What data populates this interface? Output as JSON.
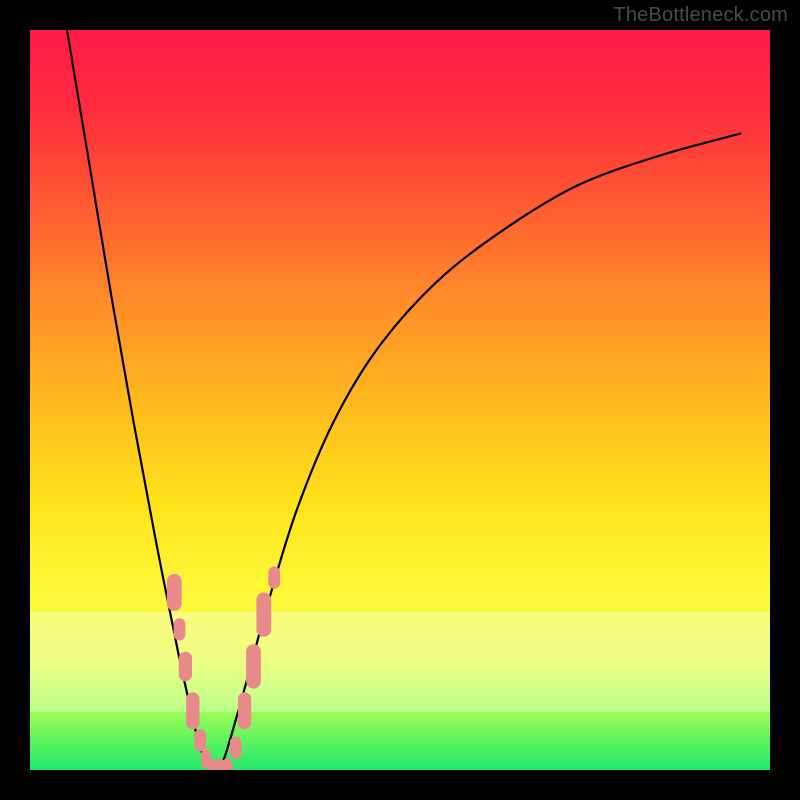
{
  "watermark": "TheBottleneck.com",
  "chart_data": {
    "type": "line",
    "title": "",
    "xlabel": "",
    "ylabel": "",
    "xlim": [
      0,
      100
    ],
    "ylim": [
      0,
      100
    ],
    "legend": false,
    "grid": false,
    "background_gradient": [
      "#ff1a48",
      "#ff8a2a",
      "#ffe31a",
      "#22e86b"
    ],
    "series": [
      {
        "name": "bottleneck-curve",
        "x": [
          5,
          8,
          11,
          14,
          17,
          20,
          22,
          23,
          24,
          25,
          26,
          27,
          29,
          32,
          36,
          41,
          47,
          55,
          64,
          74,
          85,
          96
        ],
        "y": [
          100,
          82,
          64,
          47,
          31,
          16,
          7,
          3,
          1,
          0,
          1,
          4,
          11,
          22,
          35,
          47,
          57,
          66,
          73,
          79,
          83,
          86
        ]
      }
    ],
    "markers": [
      {
        "name": "pink-beads",
        "shape": "rounded-rect",
        "color": "#e98a8a",
        "points": [
          {
            "x": 19.5,
            "y": 24,
            "w": 2.0,
            "h": 5
          },
          {
            "x": 20.2,
            "y": 19,
            "w": 1.6,
            "h": 3
          },
          {
            "x": 21.0,
            "y": 14,
            "w": 1.8,
            "h": 4
          },
          {
            "x": 22.0,
            "y": 8,
            "w": 1.8,
            "h": 5
          },
          {
            "x": 23.0,
            "y": 4,
            "w": 1.6,
            "h": 3
          },
          {
            "x": 23.8,
            "y": 1.5,
            "w": 1.4,
            "h": 2.5
          },
          {
            "x": 24.6,
            "y": 0.5,
            "w": 1.4,
            "h": 2
          },
          {
            "x": 25.6,
            "y": 0.5,
            "w": 1.6,
            "h": 2
          },
          {
            "x": 26.6,
            "y": 0.5,
            "w": 1.6,
            "h": 2
          },
          {
            "x": 27.8,
            "y": 3,
            "w": 1.6,
            "h": 3
          },
          {
            "x": 29.0,
            "y": 8,
            "w": 1.8,
            "h": 5
          },
          {
            "x": 30.2,
            "y": 14,
            "w": 2.0,
            "h": 6
          },
          {
            "x": 31.6,
            "y": 21,
            "w": 2.0,
            "h": 6
          },
          {
            "x": 33.0,
            "y": 26,
            "w": 1.6,
            "h": 3
          }
        ]
      }
    ]
  }
}
